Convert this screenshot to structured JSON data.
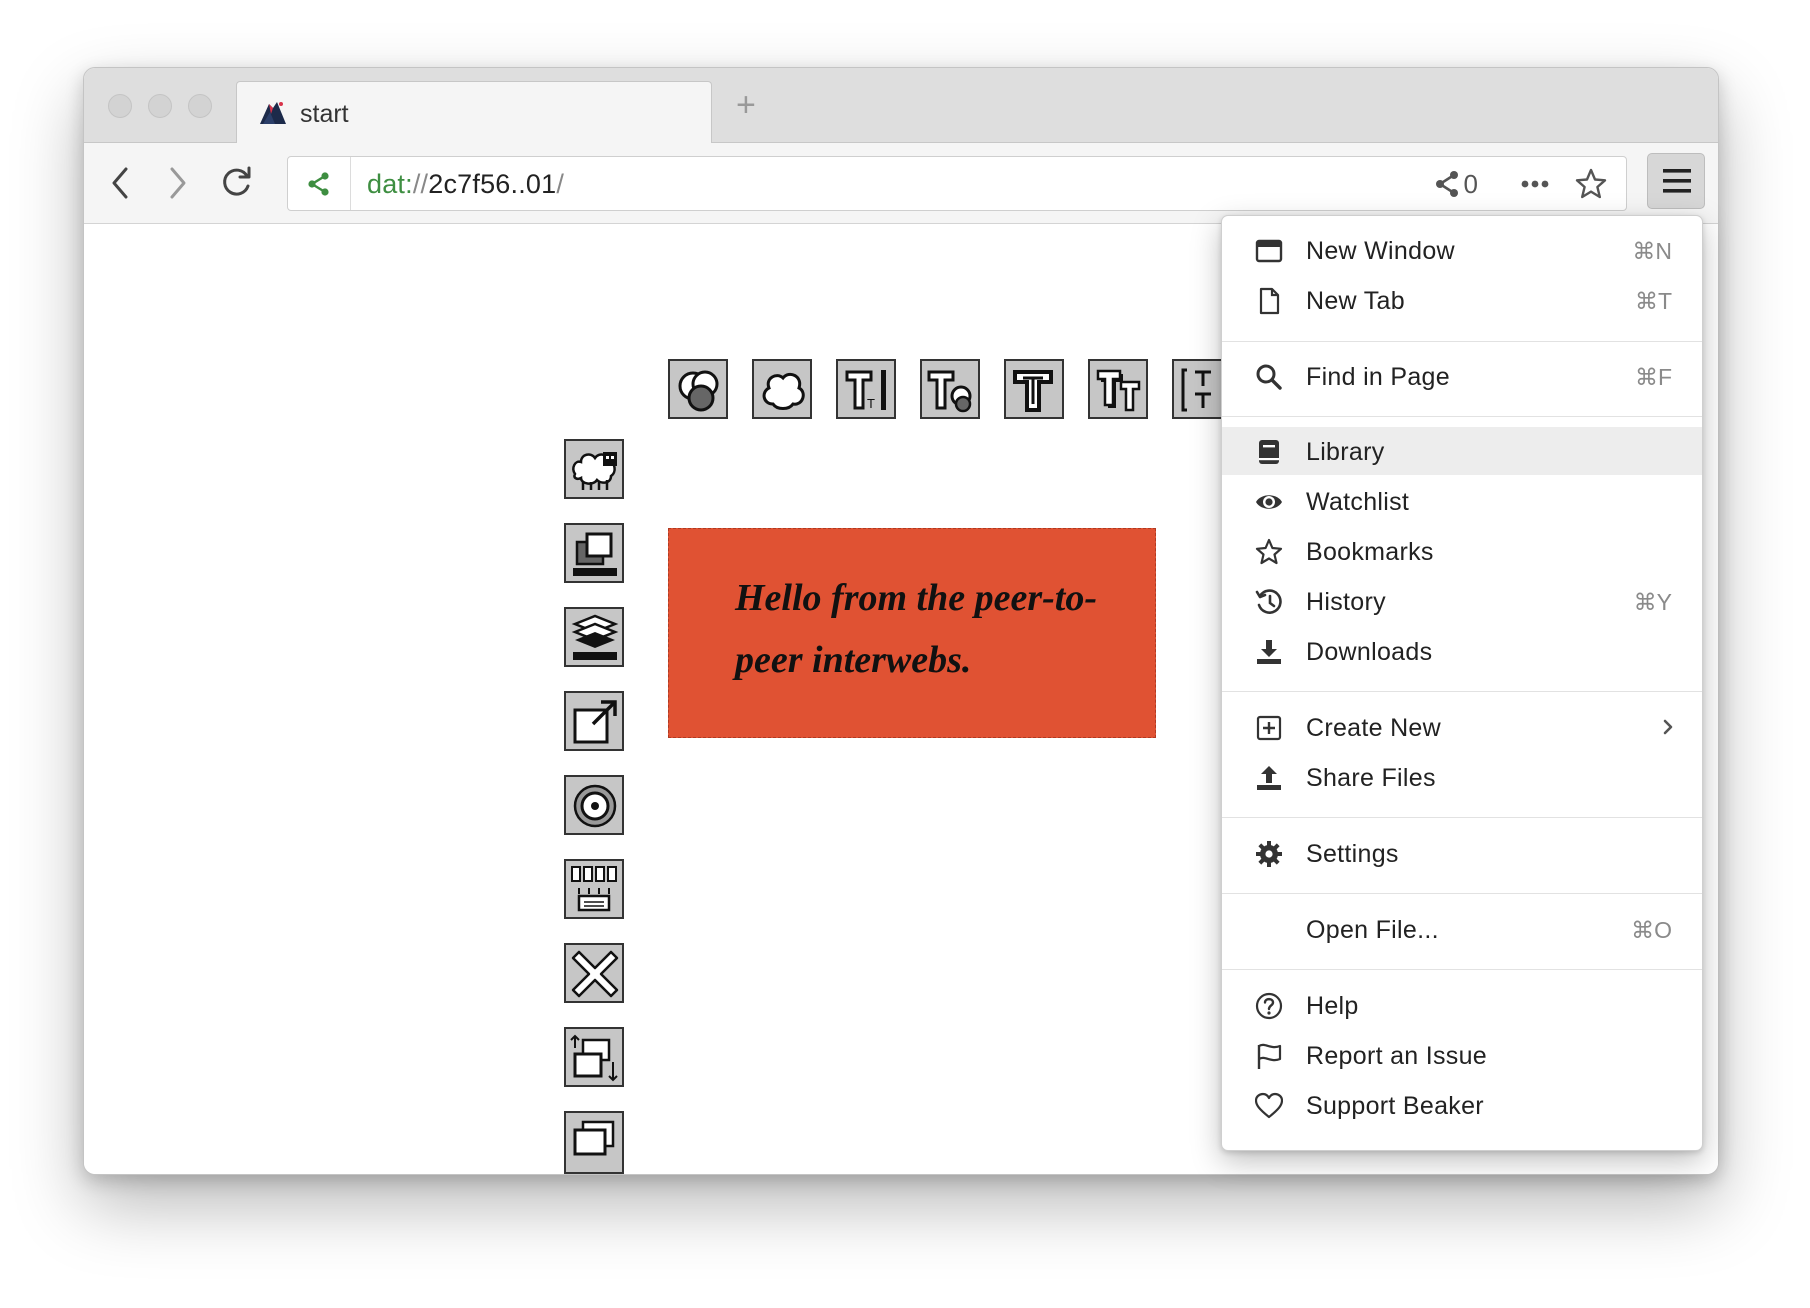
{
  "tab": {
    "title": "start"
  },
  "urlbar": {
    "protocol": "dat:",
    "slashes": "//",
    "host": "2c7f56..01",
    "trail": "/",
    "peer_count": "0"
  },
  "page": {
    "message": "Hello from the peer-to-peer interwebs.",
    "card_color": "#e05233"
  },
  "menu": {
    "new_window": {
      "label": "New Window",
      "shortcut": "⌘N"
    },
    "new_tab": {
      "label": "New Tab",
      "shortcut": "⌘T"
    },
    "find": {
      "label": "Find in Page",
      "shortcut": "⌘F"
    },
    "library": {
      "label": "Library"
    },
    "watchlist": {
      "label": "Watchlist"
    },
    "bookmarks": {
      "label": "Bookmarks"
    },
    "history": {
      "label": "History",
      "shortcut": "⌘Y"
    },
    "downloads": {
      "label": "Downloads"
    },
    "create_new": {
      "label": "Create New"
    },
    "share_files": {
      "label": "Share Files"
    },
    "settings": {
      "label": "Settings"
    },
    "open_file": {
      "label": "Open File...",
      "shortcut": "⌘O"
    },
    "help": {
      "label": "Help"
    },
    "report": {
      "label": "Report an Issue"
    },
    "support": {
      "label": "Support Beaker"
    }
  },
  "icons": {
    "nav": [
      "back-arrow-icon",
      "forward-arrow-icon",
      "reload-icon",
      "share-network-icon",
      "ellipsis-icon",
      "star-icon",
      "hamburger-menu-icon"
    ],
    "palette_top": [
      "color-circles-icon",
      "cloud-shape-icon",
      "text-tool-icon",
      "text-shape-icon",
      "text-outline-icon",
      "text-shadow-icon",
      "text-spacing-icon"
    ],
    "palette_left": [
      "sheep-icon",
      "bring-front-icon",
      "layers-icon",
      "open-external-icon",
      "target-icon",
      "distribute-icon",
      "delete-x-icon",
      "resize-frames-icon",
      "duplicate-icon"
    ]
  }
}
